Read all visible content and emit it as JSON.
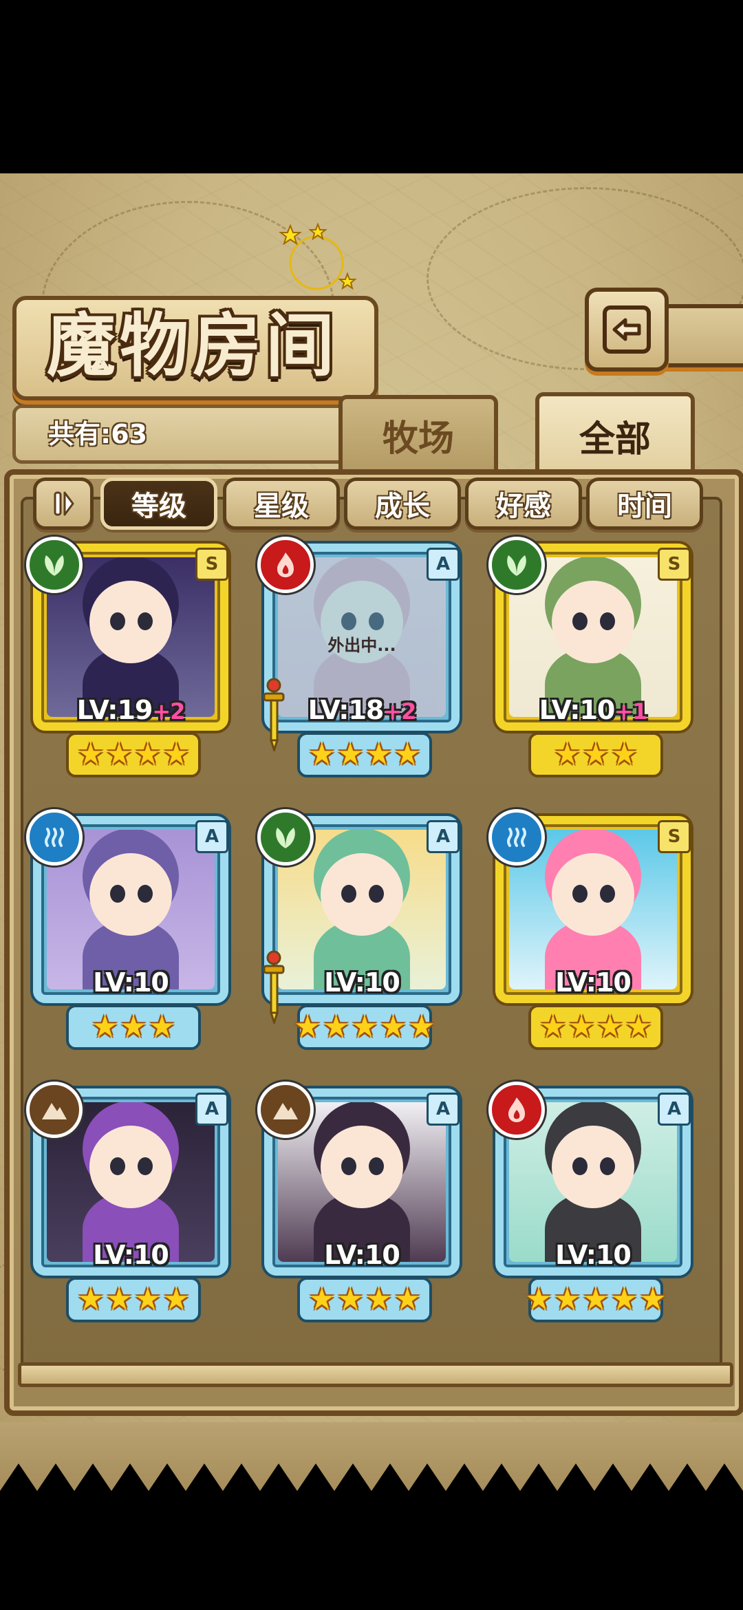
{
  "header": {
    "title": "魔物房间"
  },
  "count": {
    "text": "共有:63"
  },
  "tabs": [
    {
      "label": "牧场",
      "active": false
    },
    {
      "label": "全部",
      "active": true
    }
  ],
  "sort": {
    "toggle_icon": "pause-sort-icon",
    "buttons": [
      {
        "label": "等级",
        "active": true
      },
      {
        "label": "星级",
        "active": false
      },
      {
        "label": "成长",
        "active": false
      },
      {
        "label": "好感",
        "active": false
      },
      {
        "label": "时间",
        "active": false
      }
    ]
  },
  "monsters": [
    {
      "level": "LV:19",
      "bonus": "+2",
      "rank": "S",
      "element": "leaf",
      "stars": 4,
      "status": "",
      "equipped": false,
      "frame": "gold"
    },
    {
      "level": "LV:18",
      "bonus": "+2",
      "rank": "A",
      "element": "fire",
      "stars": 4,
      "status": "外出中...",
      "equipped": true,
      "frame": "blue"
    },
    {
      "level": "LV:10",
      "bonus": "+1",
      "rank": "S",
      "element": "leaf",
      "stars": 3,
      "status": "",
      "equipped": false,
      "frame": "gold"
    },
    {
      "level": "LV:10",
      "bonus": "",
      "rank": "A",
      "element": "water",
      "stars": 3,
      "status": "",
      "equipped": false,
      "frame": "blue"
    },
    {
      "level": "LV:10",
      "bonus": "",
      "rank": "A",
      "element": "leaf",
      "stars": 5,
      "status": "",
      "equipped": true,
      "frame": "blue"
    },
    {
      "level": "LV:10",
      "bonus": "",
      "rank": "S",
      "element": "water",
      "stars": 4,
      "status": "",
      "equipped": false,
      "frame": "gold"
    },
    {
      "level": "LV:10",
      "bonus": "",
      "rank": "A",
      "element": "earth",
      "stars": 4,
      "status": "",
      "equipped": false,
      "frame": "blue"
    },
    {
      "level": "LV:10",
      "bonus": "",
      "rank": "A",
      "element": "earth",
      "stars": 4,
      "status": "",
      "equipped": false,
      "frame": "blue"
    },
    {
      "level": "LV:10",
      "bonus": "",
      "rank": "A",
      "element": "fire",
      "stars": 5,
      "status": "",
      "equipped": false,
      "frame": "blue"
    }
  ],
  "colors": {
    "leaf": "#2f7a2a",
    "fire": "#c8191b",
    "water": "#1f7fc4",
    "earth": "#6b4420"
  }
}
